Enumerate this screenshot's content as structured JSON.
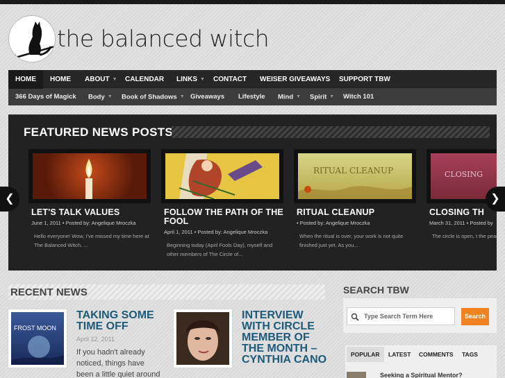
{
  "site": {
    "logo_text": "the balanced witch"
  },
  "nav_primary": [
    {
      "label": "HOME",
      "dropdown": false
    },
    {
      "label": "HOME",
      "dropdown": false
    },
    {
      "label": "ABOUT",
      "dropdown": true
    },
    {
      "label": "CALENDAR",
      "dropdown": false
    },
    {
      "label": "LINKS",
      "dropdown": true
    },
    {
      "label": "CONTACT",
      "dropdown": false
    },
    {
      "label": "WEISER GIVEAWAYS",
      "dropdown": false
    },
    {
      "label": "SUPPORT TBW",
      "dropdown": false
    }
  ],
  "nav_secondary": [
    {
      "label": "366 Days of Magick",
      "dropdown": false
    },
    {
      "label": "Body",
      "dropdown": true
    },
    {
      "label": "Book of Shadows",
      "dropdown": true
    },
    {
      "label": "Giveaways",
      "dropdown": false
    },
    {
      "label": "Lifestyle",
      "dropdown": false
    },
    {
      "label": "Mind",
      "dropdown": true
    },
    {
      "label": "Spirit",
      "dropdown": true
    },
    {
      "label": "Witch 101",
      "dropdown": false
    }
  ],
  "featured": {
    "title": "FEATURED NEWS POSTS",
    "prev_arrow": "❮",
    "next_arrow": "❯",
    "cards": [
      {
        "title": "LET'S TALK VALUES",
        "meta": "June 1, 2011 • Posted by: Angelique Mroczka",
        "excerpt": "Hello everyone!  Wow, I've missed my time here at The Balanced Witch. ..."
      },
      {
        "title": "FOLLOW THE PATH OF THE FOOL",
        "meta": "April 1, 2011 • Posted by: Angelique Mroczka",
        "excerpt": "Beginning today (April Fools Day), myself and other members of The Circle of..."
      },
      {
        "title": "RITUAL CLEANUP",
        "meta": "• Posted by: Angelique Mroczka",
        "excerpt": "When the ritual is over, your work is not quite finished just yet.  As you...",
        "image_text": "RITUAL CLEANUP"
      },
      {
        "title": "CLOSING TH",
        "meta": "March 31, 2011 • Posted by",
        "excerpt": "The circle is open, t the peace of the Go",
        "image_text": "CLOSING"
      }
    ]
  },
  "recent": {
    "title": "RECENT NEWS",
    "posts": [
      {
        "title": "TAKING SOME TIME OFF",
        "date": "April 12, 2011",
        "text": "If you hadn't already noticed, things have been a little quiet around",
        "thumb_text": "FROST MOON"
      },
      {
        "title": "INTERVIEW WITH CIRCLE MEMBER OF THE MONTH – CYNTHIA CANO",
        "date": "",
        "text": ""
      }
    ]
  },
  "search": {
    "title": "SEARCH TBW",
    "placeholder": "Type Search Term Here",
    "button": "Search"
  },
  "tabs": {
    "items": [
      "POPULAR",
      "LATEST",
      "COMMENTS",
      "TAGS"
    ],
    "active": "POPULAR",
    "first_entry": "Seeking a Spiritual Mentor?"
  }
}
